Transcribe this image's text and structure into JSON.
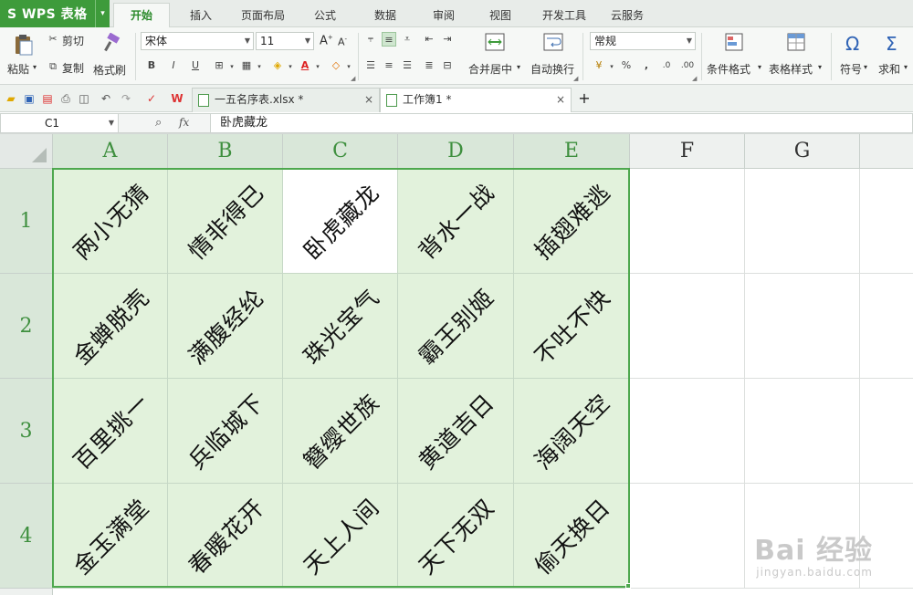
{
  "app": {
    "name": "WPS 表格",
    "logo_glyph": "S",
    "accent": "#3e9b3b"
  },
  "ribbon_tabs": [
    "开始",
    "插入",
    "页面布局",
    "公式",
    "数据",
    "审阅",
    "视图",
    "开发工具",
    "云服务"
  ],
  "active_tab": "开始",
  "ribbon": {
    "clipboard": {
      "paste": "粘贴",
      "cut": "剪切",
      "copy": "复制",
      "format_painter": "格式刷"
    },
    "font": {
      "name": "宋体",
      "size": "11",
      "grow": "A",
      "shrink": "A",
      "bold": "B",
      "italic": "I",
      "underline": "U"
    },
    "align": {
      "merge_center": "合并居中",
      "wrap": "自动换行"
    },
    "number": {
      "format": "常规",
      "percent": "%",
      "thousands": ",",
      "inc_decimal": ".0",
      "dec_decimal": ".00"
    },
    "styles": {
      "conditional": "条件格式",
      "table_style": "表格样式"
    },
    "editing": {
      "symbol": "符号",
      "sum": "求和",
      "symbol_glyph": "Ω",
      "sum_glyph": "Σ"
    }
  },
  "doc_tabs": [
    {
      "name": "一五名序表.xlsx *",
      "active": false
    },
    {
      "name": "工作簿1 *",
      "active": true
    }
  ],
  "new_tab_glyph": "+",
  "formula_bar": {
    "cell_ref": "C1",
    "fx": "fx",
    "content": "卧虎藏龙"
  },
  "columns": [
    "A",
    "B",
    "C",
    "D",
    "E",
    "F",
    "G"
  ],
  "rows": [
    "1",
    "2",
    "3",
    "4"
  ],
  "cells": [
    [
      "两小无猜",
      "情非得已",
      "卧虎藏龙",
      "背水一战",
      "插翅难逃"
    ],
    [
      "金蝉脱壳",
      "满腹经纶",
      "珠光宝气",
      "霸王别姬",
      "不吐不快"
    ],
    [
      "百里挑一",
      "兵临城下",
      "簪缨世族",
      "黄道吉日",
      "海阔天空"
    ],
    [
      "金玉满堂",
      "春暖花开",
      "天上人间",
      "天下无双",
      "偷天换日"
    ]
  ],
  "active_cell": "C1",
  "watermark": {
    "main": "Bai 经验",
    "sub": "jingyan.baidu.com"
  }
}
